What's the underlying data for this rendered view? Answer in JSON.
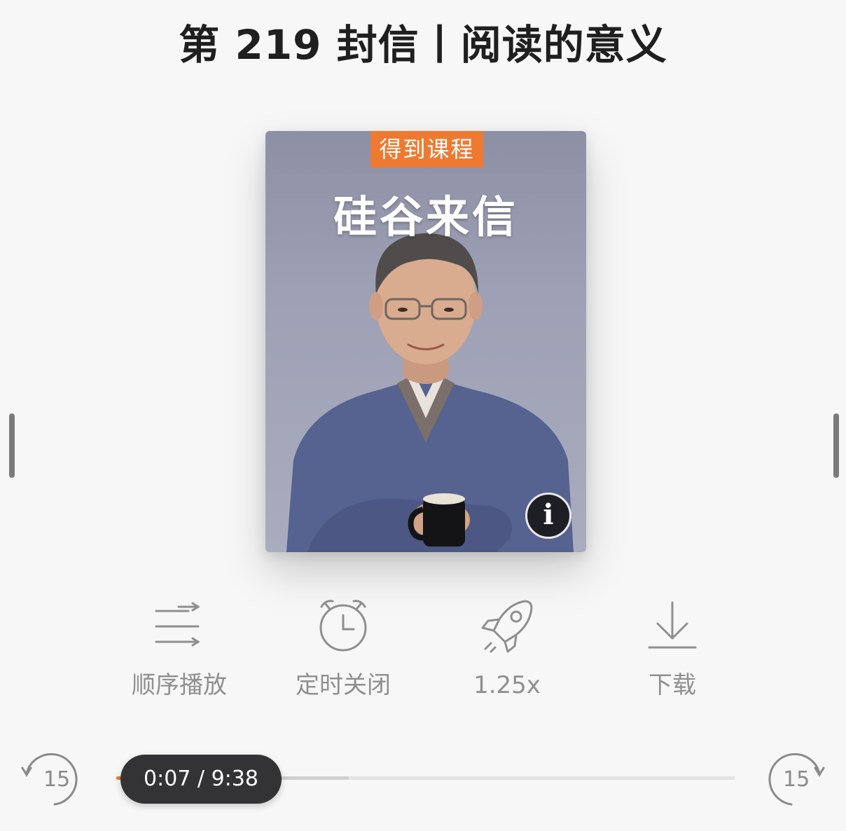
{
  "header": {
    "title": "第 219 封信丨阅读的意义"
  },
  "cover": {
    "badge": "得到课程",
    "title": "硅谷来信",
    "info_label": "i"
  },
  "controls": [
    {
      "label": "顺序播放",
      "icon": "playlist-order-icon"
    },
    {
      "label": "定时关闭",
      "icon": "alarm-clock-icon"
    },
    {
      "label": "1.25x",
      "icon": "rocket-icon"
    },
    {
      "label": "下载",
      "icon": "download-icon"
    }
  ],
  "player": {
    "skip_back_label": "15",
    "skip_forward_label": "15",
    "time_display": "0:07 / 9:38",
    "progress": {
      "played": 0.012,
      "buffered": 0.375
    }
  },
  "colors": {
    "accent": "#ee7a32",
    "background": "#f7f7f7",
    "icon": "#8f8f8f",
    "pill": "#333335"
  }
}
